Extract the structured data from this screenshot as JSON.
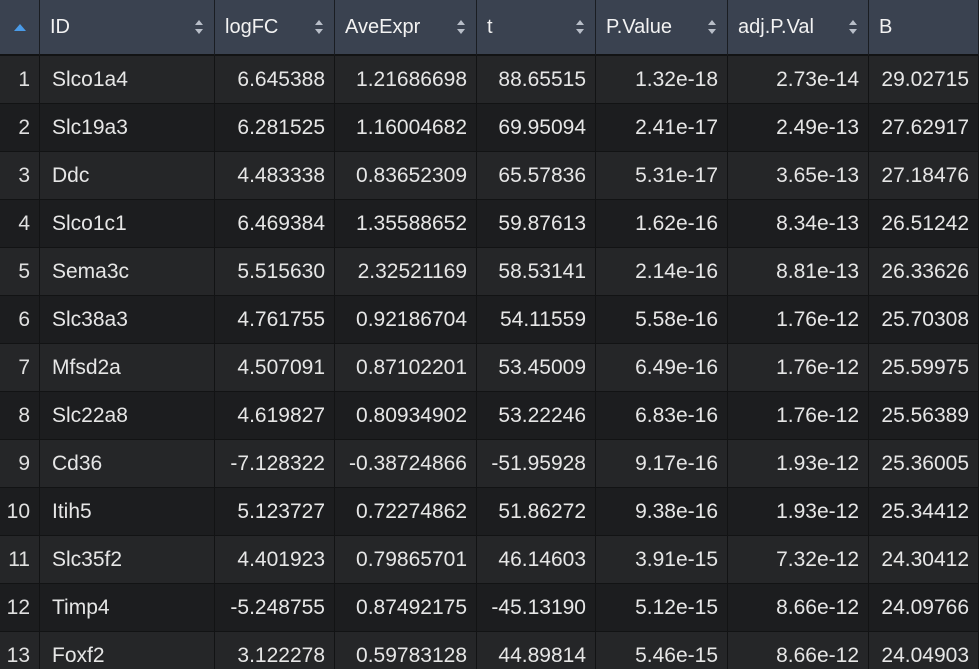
{
  "table": {
    "columns": [
      {
        "key": "id",
        "label": "ID",
        "align": "left"
      },
      {
        "key": "logfc",
        "label": "logFC",
        "align": "right"
      },
      {
        "key": "aveexpr",
        "label": "AveExpr",
        "align": "right"
      },
      {
        "key": "t",
        "label": "t",
        "align": "right"
      },
      {
        "key": "pvalue",
        "label": "P.Value",
        "align": "right"
      },
      {
        "key": "adjpval",
        "label": "adj.P.Val",
        "align": "right"
      },
      {
        "key": "b",
        "label": "B",
        "align": "right"
      }
    ],
    "sort_indicator": "sort-ascending-icon",
    "rows": [
      [
        "1",
        "Slco1a4",
        "6.645388",
        "1.21686698",
        "88.65515",
        "1.32e-18",
        "2.73e-14",
        "29.02715"
      ],
      [
        "2",
        "Slc19a3",
        "6.281525",
        "1.16004682",
        "69.95094",
        "2.41e-17",
        "2.49e-13",
        "27.62917"
      ],
      [
        "3",
        "Ddc",
        "4.483338",
        "0.83652309",
        "65.57836",
        "5.31e-17",
        "3.65e-13",
        "27.18476"
      ],
      [
        "4",
        "Slco1c1",
        "6.469384",
        "1.35588652",
        "59.87613",
        "1.62e-16",
        "8.34e-13",
        "26.51242"
      ],
      [
        "5",
        "Sema3c",
        "5.515630",
        "2.32521169",
        "58.53141",
        "2.14e-16",
        "8.81e-13",
        "26.33626"
      ],
      [
        "6",
        "Slc38a3",
        "4.761755",
        "0.92186704",
        "54.11559",
        "5.58e-16",
        "1.76e-12",
        "25.70308"
      ],
      [
        "7",
        "Mfsd2a",
        "4.507091",
        "0.87102201",
        "53.45009",
        "6.49e-16",
        "1.76e-12",
        "25.59975"
      ],
      [
        "8",
        "Slc22a8",
        "4.619827",
        "0.80934902",
        "53.22246",
        "6.83e-16",
        "1.76e-12",
        "25.56389"
      ],
      [
        "9",
        "Cd36",
        "-7.128322",
        "-0.38724866",
        "-51.95928",
        "9.17e-16",
        "1.93e-12",
        "25.36005"
      ],
      [
        "10",
        "Itih5",
        "5.123727",
        "0.72274862",
        "51.86272",
        "9.38e-16",
        "1.93e-12",
        "25.34412"
      ],
      [
        "11",
        "Slc35f2",
        "4.401923",
        "0.79865701",
        "46.14603",
        "3.91e-15",
        "7.32e-12",
        "24.30412"
      ],
      [
        "12",
        "Timp4",
        "-5.248755",
        "0.87492175",
        "-45.13190",
        "5.12e-15",
        "8.66e-12",
        "24.09766"
      ],
      [
        "13",
        "Foxf2",
        "3.122278",
        "0.59783128",
        "44.89814",
        "5.46e-15",
        "8.66e-12",
        "24.04903"
      ]
    ]
  },
  "colors": {
    "header_bg": "#3a4250",
    "row_odd": "#252628",
    "row_even": "#1c1d1f",
    "accent": "#4a9be8"
  }
}
